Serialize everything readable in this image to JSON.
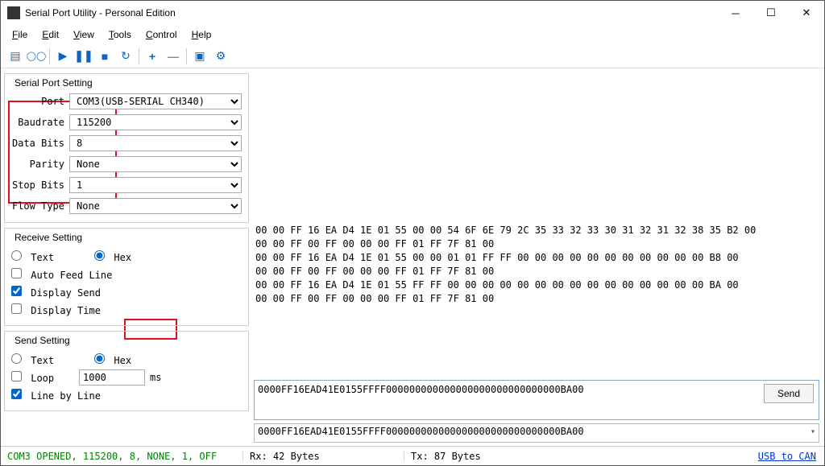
{
  "window": {
    "title": "Serial Port Utility - Personal Edition"
  },
  "menu": {
    "file": "File",
    "edit": "Edit",
    "view": "View",
    "tools": "Tools",
    "control": "Control",
    "help": "Help"
  },
  "serial": {
    "group": "Serial Port Setting",
    "port_lbl": "Port",
    "port": "COM3(USB-SERIAL CH340)",
    "baud_lbl": "Baudrate",
    "baud": "115200",
    "databits_lbl": "Data Bits",
    "databits": "8",
    "parity_lbl": "Parity",
    "parity": "None",
    "stopbits_lbl": "Stop Bits",
    "stopbits": "1",
    "flow_lbl": "Flow Type",
    "flow": "None"
  },
  "receive": {
    "group": "Receive Setting",
    "text": "Text",
    "hex": "Hex",
    "autofeed": "Auto Feed Line",
    "displaysend": "Display Send",
    "displaytime": "Display Time"
  },
  "send": {
    "group": "Send Setting",
    "text": "Text",
    "hex": "Hex",
    "loop": "Loop",
    "loop_val": "1000",
    "ms": "ms",
    "linebyline": "Line by Line",
    "button": "Send",
    "value": "0000FF16EAD41E0155FFFF000000000000000000000000000000BA00",
    "history": "0000FF16EAD41E0155FFFF000000000000000000000000000000BA00"
  },
  "log": {
    "l1": "00 00 FF 16 EA D4 1E 01 55 00 00 54 6F 6E 79 2C 35 33 32 33 30 31 32 31 32 38 35 B2 00",
    "l2": "00 00 FF 00 FF 00 00 00 FF 01 FF 7F 81 00",
    "l3": "00 00 FF 16 EA D4 1E 01 55 00 00 01 01 FF FF 00 00 00 00 00 00 00 00 00 00 00 B8 00",
    "l4": "00 00 FF 00 FF 00 00 00 FF 01 FF 7F 81 00",
    "l5": "00 00 FF 16 EA D4 1E 01 55 FF FF 00 00 00 00 00 00 00 00 00 00 00 00 00 00 00 BA 00",
    "l6": "00 00 FF 00 FF 00 00 00 FF 01 FF 7F 81 00"
  },
  "status": {
    "conn": "COM3 OPENED, 115200, 8, NONE, 1, OFF",
    "rx": "Rx: 42 Bytes",
    "tx": "Tx: 87 Bytes",
    "link": "USB to CAN"
  }
}
